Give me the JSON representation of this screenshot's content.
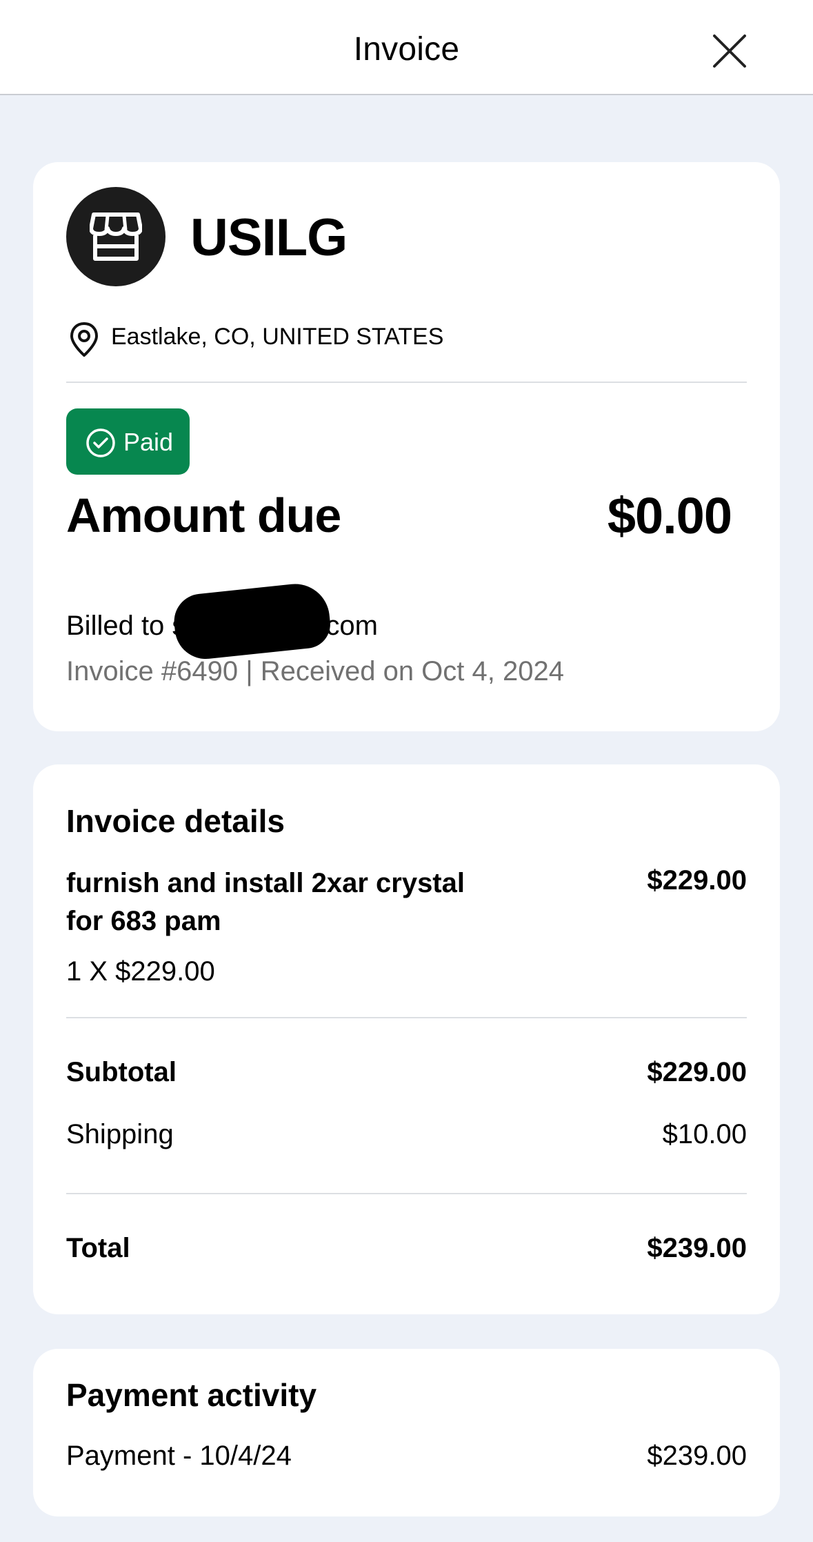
{
  "header": {
    "title": "Invoice",
    "close_icon": "close-icon"
  },
  "merchant": {
    "icon": "storefront-icon",
    "name": "USILG",
    "location_icon": "map-pin-icon",
    "location": "Eastlake, CO, UNITED STATES"
  },
  "status": {
    "icon": "check-circle-icon",
    "label": "Paid",
    "color": "#07874f"
  },
  "amount_due": {
    "label": "Amount due",
    "value": "$0.00"
  },
  "billing": {
    "billed_to": "Billed to sh        e@gmail.com",
    "invoice_info": "Invoice #6490 | Received on Oct 4, 2024"
  },
  "details": {
    "title": "Invoice details",
    "items": [
      {
        "name": "furnish and install 2xar crystal for 683 pam",
        "price": "$229.00",
        "quantity": "1 X $229.00"
      }
    ],
    "subtotal_label": "Subtotal",
    "subtotal_value": "$229.00",
    "shipping_label": "Shipping",
    "shipping_value": "$10.00",
    "total_label": "Total",
    "total_value": "$239.00"
  },
  "payment_activity": {
    "title": "Payment activity",
    "entries": [
      {
        "label": "Payment - 10/4/24",
        "amount": "$239.00"
      }
    ]
  }
}
